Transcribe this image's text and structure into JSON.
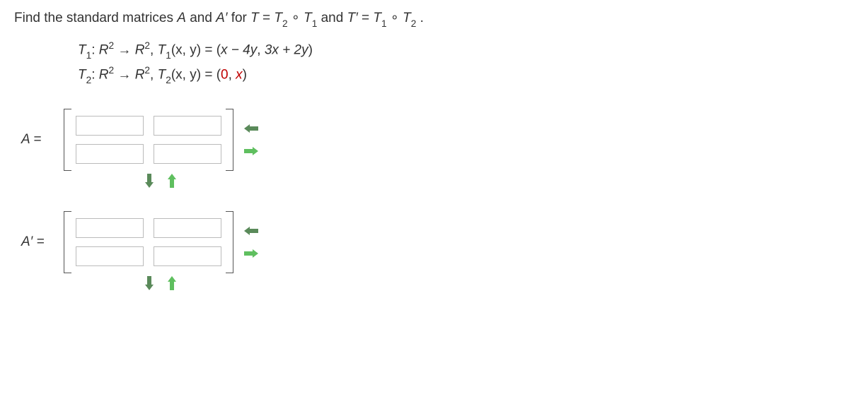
{
  "prompt": {
    "lead": "Find the standard matrices ",
    "A": "A",
    "and1": " and ",
    "Aprime": "A′",
    "for": " for  ",
    "T": "T",
    "eq1": " = ",
    "T2": "T",
    "T2sub": "2",
    "circ": " ∘ ",
    "T1": "T",
    "T1sub": "1",
    "and2": " and ",
    "Tprime": "T′",
    "eq2": " = ",
    "T1b": "T",
    "T1bsub": "1",
    "circ2": " ∘ ",
    "T2b": "T",
    "T2bsub": "2",
    "dot": "."
  },
  "defs": {
    "line1": {
      "T1": "T",
      "T1sub": "1",
      "colon": ": ",
      "R": "R",
      "sq": "2",
      "arrow": " → ",
      "R2": "R",
      "sq2": "2",
      "comma": ", ",
      "T1b": "T",
      "T1bsub": "1",
      "args": "(x, y)",
      "eq": " = ",
      "rhs_open": "(",
      "rhs1": "x − 4y",
      "rhs_c": ", ",
      "rhs2": "3x + 2y",
      "rhs_close": ")"
    },
    "line2": {
      "T2": "T",
      "T2sub": "2",
      "colon": ": ",
      "R": "R",
      "sq": "2",
      "arrow": " → ",
      "R2": "R",
      "sq2": "2",
      "comma": ", ",
      "T2b": "T",
      "T2bsub": "2",
      "args": "(x, y)",
      "eq": " = ",
      "rhs_open": "(",
      "rhs1": "0",
      "rhs_c": ", ",
      "rhs2": "x",
      "rhs_close": ")"
    }
  },
  "matrices": {
    "A": {
      "label": "A =",
      "cells": [
        "",
        "",
        "",
        ""
      ]
    },
    "Aprime": {
      "label": "A′ =",
      "cells": [
        "",
        "",
        "",
        ""
      ]
    }
  },
  "icons": {
    "left": "arrow-left",
    "right": "arrow-right",
    "down": "arrow-down",
    "up": "arrow-up"
  }
}
